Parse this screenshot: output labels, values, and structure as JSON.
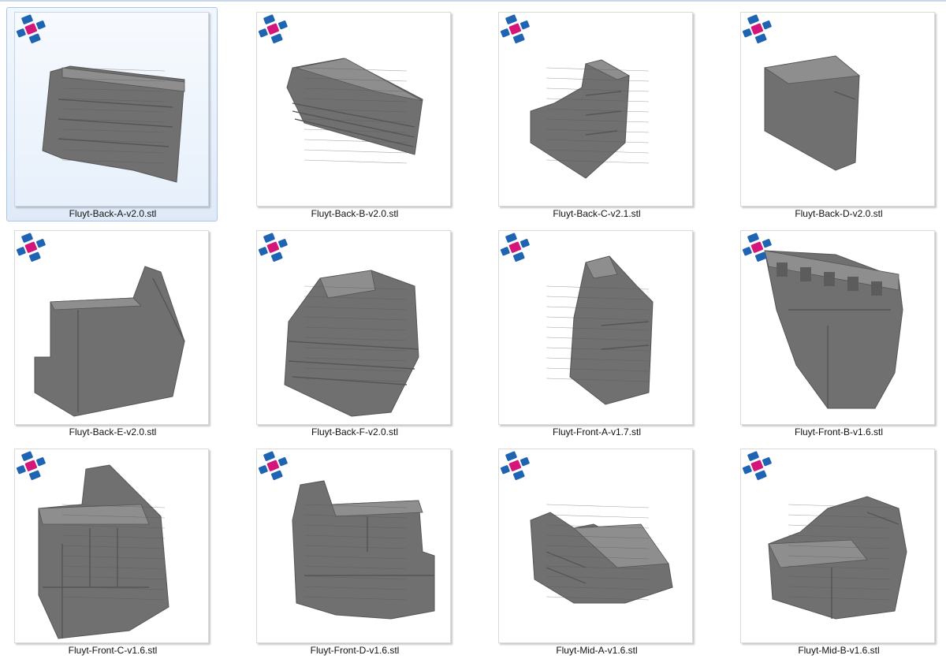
{
  "colors": {
    "model_fill": "#707070",
    "model_dark": "#555555",
    "model_light": "#8e8e8e",
    "badge_blue": "#1f64b2",
    "badge_magenta": "#d4157a",
    "selection_border": "#a9c6ea"
  },
  "files": [
    {
      "name": "Fluyt-Back-A-v2.0.stl",
      "selected": true,
      "icon": "stl-model-thumbnail",
      "badge_icon": "3d-viewer-badge-icon"
    },
    {
      "name": "Fluyt-Back-B-v2.0.stl",
      "selected": false,
      "icon": "stl-model-thumbnail",
      "badge_icon": "3d-viewer-badge-icon"
    },
    {
      "name": "Fluyt-Back-C-v2.1.stl",
      "selected": false,
      "icon": "stl-model-thumbnail",
      "badge_icon": "3d-viewer-badge-icon"
    },
    {
      "name": "Fluyt-Back-D-v2.0.stl",
      "selected": false,
      "icon": "stl-model-thumbnail",
      "badge_icon": "3d-viewer-badge-icon"
    },
    {
      "name": "Fluyt-Back-E-v2.0.stl",
      "selected": false,
      "icon": "stl-model-thumbnail",
      "badge_icon": "3d-viewer-badge-icon"
    },
    {
      "name": "Fluyt-Back-F-v2.0.stl",
      "selected": false,
      "icon": "stl-model-thumbnail",
      "badge_icon": "3d-viewer-badge-icon"
    },
    {
      "name": "Fluyt-Front-A-v1.7.stl",
      "selected": false,
      "icon": "stl-model-thumbnail",
      "badge_icon": "3d-viewer-badge-icon"
    },
    {
      "name": "Fluyt-Front-B-v1.6.stl",
      "selected": false,
      "icon": "stl-model-thumbnail",
      "badge_icon": "3d-viewer-badge-icon"
    },
    {
      "name": "Fluyt-Front-C-v1.6.stl",
      "selected": false,
      "icon": "stl-model-thumbnail",
      "badge_icon": "3d-viewer-badge-icon"
    },
    {
      "name": "Fluyt-Front-D-v1.6.stl",
      "selected": false,
      "icon": "stl-model-thumbnail",
      "badge_icon": "3d-viewer-badge-icon"
    },
    {
      "name": "Fluyt-Mid-A-v1.6.stl",
      "selected": false,
      "icon": "stl-model-thumbnail",
      "badge_icon": "3d-viewer-badge-icon"
    },
    {
      "name": "Fluyt-Mid-B-v1.6.stl",
      "selected": false,
      "icon": "stl-model-thumbnail",
      "badge_icon": "3d-viewer-badge-icon"
    }
  ]
}
